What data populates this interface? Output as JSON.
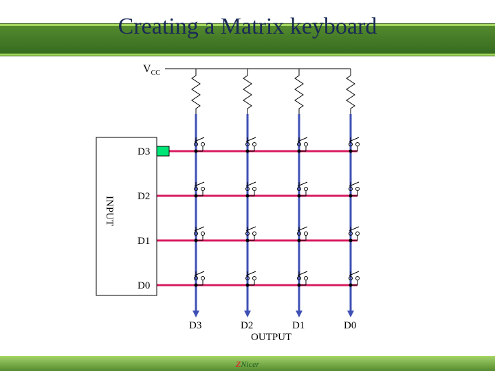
{
  "title": "Creating a Matrix keyboard",
  "vcc_label": "V",
  "vcc_sub": "CC",
  "input_label": "INPUT",
  "output_label": "OUTPUT",
  "rows": [
    "D3",
    "D2",
    "D1",
    "D0"
  ],
  "cols": [
    "D3",
    "D2",
    "D1",
    "D0"
  ],
  "footer_logo": {
    "z": "Z",
    "rest": "Nicer"
  },
  "chart_data": {
    "type": "diagram",
    "description": "4x4 matrix keyboard schematic",
    "supply": "VCC via pull-up resistors on each column",
    "row_lines": [
      "D3",
      "D2",
      "D1",
      "D0"
    ],
    "column_lines": [
      "D3",
      "D2",
      "D1",
      "D0"
    ],
    "row_port": "INPUT",
    "column_port": "OUTPUT",
    "switches": "one normally-open push switch at every row/column intersection (16 total)",
    "highlighted_row": "D3"
  }
}
